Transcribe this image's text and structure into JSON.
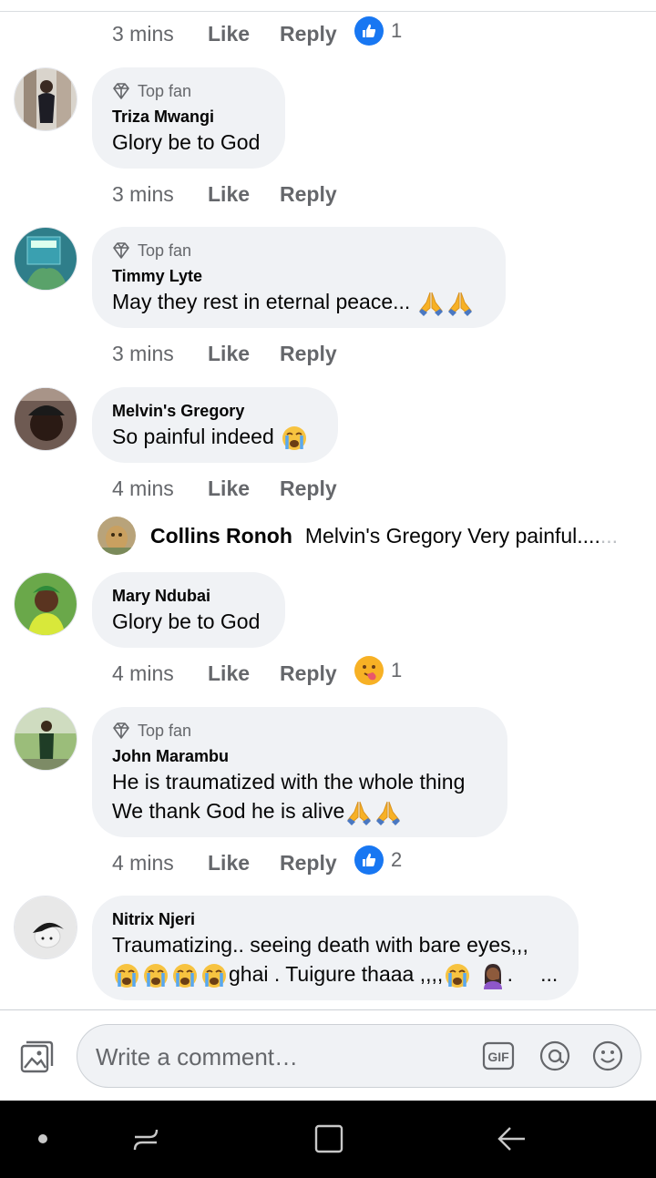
{
  "comments": [
    {
      "time": "3 mins",
      "like": "Like",
      "reply": "Reply",
      "reaction": {
        "type": "like",
        "count": "1"
      }
    },
    {
      "badge": "Top fan",
      "author": "Triza Mwangi",
      "lines": [
        "Glory be to God"
      ],
      "time": "3 mins",
      "like": "Like",
      "reply": "Reply"
    },
    {
      "badge": "Top fan",
      "author": "Timmy Lyte",
      "lines": [
        "May they rest in eternal peace..."
      ],
      "time": "3 mins",
      "like": "Like",
      "reply": "Reply"
    },
    {
      "author": "Melvin's Gregory",
      "lines": [
        "So painful indeed"
      ],
      "time": "4 mins",
      "like": "Like",
      "reply": "Reply",
      "reply_preview": {
        "author": "Collins Ronoh",
        "text": "Melvin's Gregory  Very painful....",
        "fade": "..."
      }
    },
    {
      "author": "Mary Ndubai",
      "lines": [
        "Glory be to God"
      ],
      "time": "4 mins",
      "like": "Like",
      "reply": "Reply",
      "reaction": {
        "type": "wow",
        "count": "1"
      }
    },
    {
      "badge": "Top fan",
      "author": "John Marambu",
      "lines": [
        "He is traumatized with the whole thing",
        "We thank God he is alive"
      ],
      "time": "4 mins",
      "like": "Like",
      "reply": "Reply",
      "reaction": {
        "type": "like",
        "count": "2"
      }
    },
    {
      "author": "Nitrix Njeri",
      "lines": [
        "Traumatizing.. seeing death with bare eyes,,,",
        "ghai .  Tuigure thaaa ,,,,",
        ".",
        "..."
      ]
    }
  ],
  "composer": {
    "placeholder": "Write a comment…",
    "icons": [
      "photo-icon",
      "gif-icon",
      "mention-icon",
      "emoji-icon"
    ]
  },
  "nav": {
    "icons": [
      "nav-dot-icon",
      "recents-icon",
      "home-icon",
      "back-icon"
    ]
  },
  "colors": {
    "accent": "#1877f2",
    "bubble": "#f0f2f5",
    "meta": "#65676b",
    "text": "#050505",
    "navbar": "#000000"
  }
}
